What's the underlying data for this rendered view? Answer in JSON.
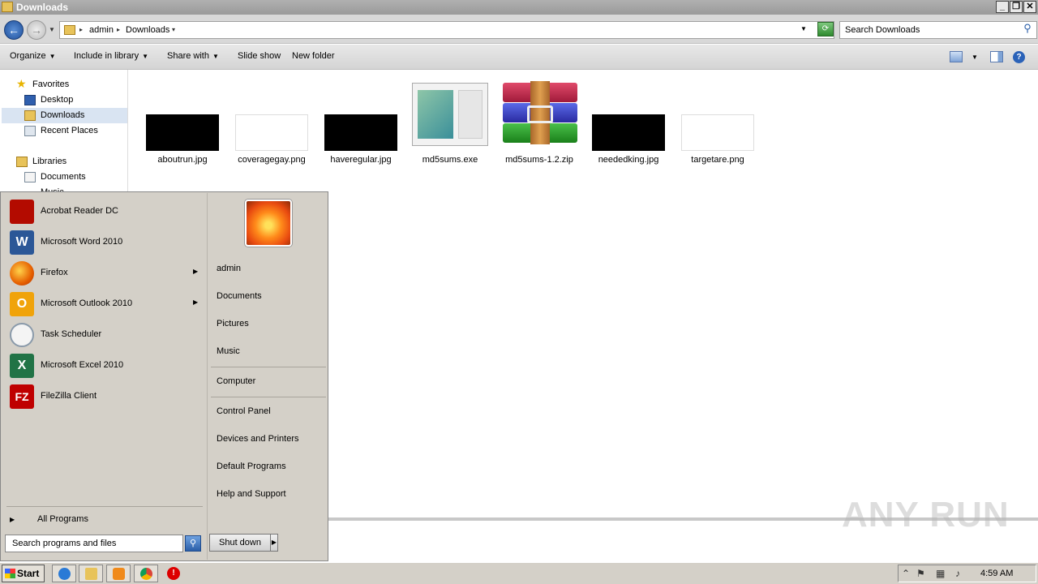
{
  "window": {
    "title": "Downloads",
    "buttons": [
      "_",
      "❐",
      "✕"
    ]
  },
  "address": {
    "crumbs": [
      "admin",
      "Downloads"
    ],
    "search_placeholder": "Search Downloads"
  },
  "toolbar": {
    "organize": "Organize",
    "include_in_library": "Include in library",
    "share_with": "Share with",
    "slide_show": "Slide show",
    "new_folder": "New folder"
  },
  "sidebar": {
    "favorites": "Favorites",
    "desktop": "Desktop",
    "downloads": "Downloads",
    "recent_places": "Recent Places",
    "libraries": "Libraries",
    "documents": "Documents",
    "music_partial": "Music"
  },
  "files": [
    {
      "name": "aboutrun.jpg",
      "kind": "dark-image"
    },
    {
      "name": "coveragegay.png",
      "kind": "light-image"
    },
    {
      "name": "haveregular.jpg",
      "kind": "dark-image"
    },
    {
      "name": "md5sums.exe",
      "kind": "exe-screenshot"
    },
    {
      "name": "md5sums-1.2.zip",
      "kind": "winrar-archive"
    },
    {
      "name": "neededking.jpg",
      "kind": "dark-image"
    },
    {
      "name": "targetare.png",
      "kind": "light-image"
    }
  ],
  "startmenu": {
    "programs": [
      {
        "label": "Acrobat Reader DC",
        "icon": "acrobat-icon",
        "color": "#b30b00",
        "submenu": false
      },
      {
        "label": "Microsoft Word 2010",
        "icon": "word-icon",
        "color": "#2b5797",
        "submenu": false
      },
      {
        "label": "Firefox",
        "icon": "firefox-icon",
        "color": "#e66000",
        "submenu": true
      },
      {
        "label": "Microsoft Outlook 2010",
        "icon": "outlook-icon",
        "color": "#f0a30a",
        "submenu": true
      },
      {
        "label": "Task Scheduler",
        "icon": "clock-icon",
        "color": "#cfd8e0",
        "submenu": false
      },
      {
        "label": "Microsoft Excel 2010",
        "icon": "excel-icon",
        "color": "#217346",
        "submenu": false
      },
      {
        "label": "FileZilla Client",
        "icon": "filezilla-icon",
        "color": "#bf0000",
        "submenu": false
      }
    ],
    "all_programs": "All Programs",
    "search_placeholder": "Search programs and files",
    "right_links": [
      "admin",
      "Documents",
      "Pictures",
      "Music",
      "Computer",
      "Control Panel",
      "Devices and Printers",
      "Default Programs",
      "Help and Support"
    ],
    "shutdown": "Shut down"
  },
  "taskbar": {
    "start": "Start",
    "clock": "4:59 AM",
    "apps": [
      "ie-icon",
      "explorer-icon",
      "media-player-icon",
      "chrome-icon",
      "stop-icon"
    ]
  },
  "watermark": "ANY RUN"
}
